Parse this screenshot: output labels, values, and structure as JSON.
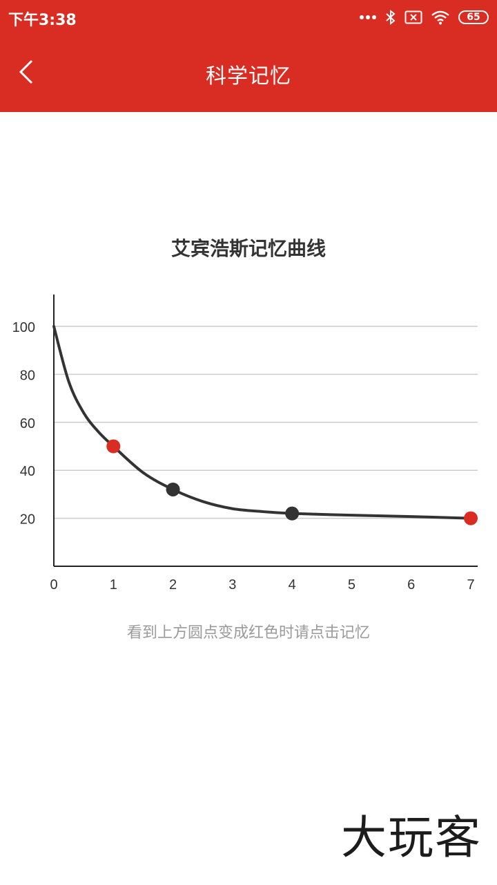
{
  "status_bar": {
    "time": "下午3:38",
    "battery_level": "65",
    "icons": [
      "dots-icon",
      "bluetooth-icon",
      "sim-error-icon",
      "wifi-icon",
      "battery-icon"
    ]
  },
  "app_bar": {
    "title": "科学记忆",
    "back_icon": "chevron-left-icon",
    "background_color": "#d92c22"
  },
  "chart_data": {
    "type": "line",
    "title": "艾宾浩斯记忆曲线",
    "x_ticks": [
      "0",
      "1",
      "2",
      "3",
      "4",
      "5",
      "6",
      "7"
    ],
    "y_ticks": [
      "20",
      "40",
      "60",
      "80",
      "100"
    ],
    "xlim": [
      0,
      7
    ],
    "ylim": [
      0,
      100
    ],
    "grid": true,
    "series": [
      {
        "x": [
          0,
          0.25,
          0.5,
          0.75,
          1,
          1.5,
          2,
          2.5,
          3,
          3.5,
          4,
          5,
          6,
          7
        ],
        "y": [
          100,
          77,
          64,
          56,
          50,
          39,
          32,
          27,
          24,
          22.8,
          22,
          21.3,
          20.7,
          20
        ]
      }
    ],
    "markers": [
      {
        "x": 1,
        "y": 50,
        "color": "#d92c22"
      },
      {
        "x": 2,
        "y": 32,
        "color": "#333333"
      },
      {
        "x": 4,
        "y": 22,
        "color": "#333333"
      },
      {
        "x": 7,
        "y": 20,
        "color": "#d92c22"
      }
    ]
  },
  "hint_text": "看到上方圆点变成红色时请点击记忆",
  "watermark_text": "大玩客"
}
